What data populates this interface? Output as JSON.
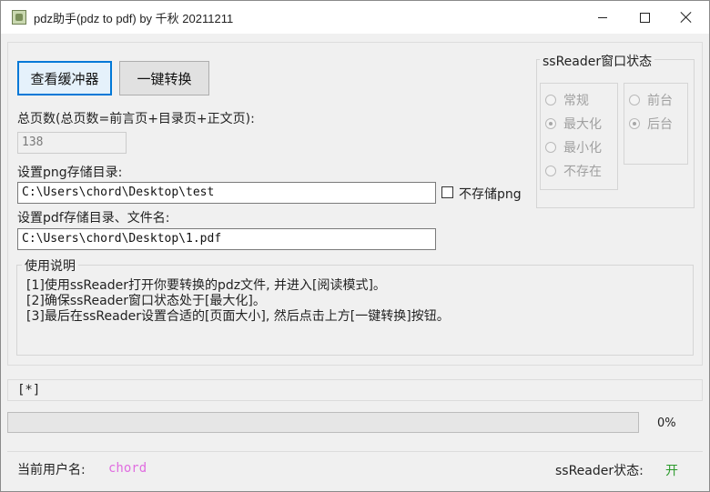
{
  "window": {
    "title": "pdz助手(pdz to pdf) by 千秋 20211211"
  },
  "buttons": {
    "buffer": "查看缓冲器",
    "convert": "一键转换"
  },
  "pages": {
    "label": "总页数(总页数=前言页+目录页+正文页):",
    "value": "138"
  },
  "png_dir": {
    "label": "设置png存储目录:",
    "value": "C:\\Users\\chord\\Desktop\\test",
    "no_store_label": "不存储png"
  },
  "pdf_dir": {
    "label": "设置pdf存储目录、文件名:",
    "value": "C:\\Users\\chord\\Desktop\\1.pdf"
  },
  "window_state": {
    "title": "ssReader窗口状态",
    "size_options": [
      {
        "label": "常规",
        "checked": false
      },
      {
        "label": "最大化",
        "checked": true
      },
      {
        "label": "最小化",
        "checked": false
      },
      {
        "label": "不存在",
        "checked": false
      }
    ],
    "z_options": [
      {
        "label": "前台",
        "checked": false
      },
      {
        "label": "后台",
        "checked": true
      }
    ]
  },
  "usage": {
    "title": "使用说明",
    "lines": [
      "[1]使用ssReader打开你要转换的pdz文件, 并进入[阅读模式]。",
      "[2]确保ssReader窗口状态处于[最大化]。",
      "[3]最后在ssReader设置合适的[页面大小], 然后点击上方[一键转换]按钮。"
    ]
  },
  "status_line": "[*]",
  "progress": {
    "percent": 0,
    "text": "0%"
  },
  "footer": {
    "user_label": "当前用户名:",
    "user_value": "chord",
    "state_label": "ssReader状态:",
    "state_value": "开"
  }
}
